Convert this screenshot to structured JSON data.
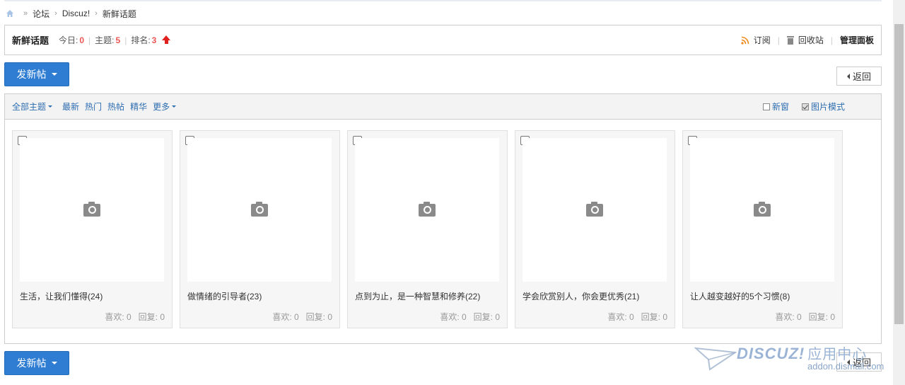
{
  "breadcrumb": {
    "items": [
      "论坛",
      "Discuz!",
      "新鲜话题"
    ],
    "separator": "›"
  },
  "forum": {
    "title": "新鲜话题",
    "today_label": "今日:",
    "today_value": "0",
    "topics_label": "主题:",
    "topics_value": "5",
    "rank_label": "排名:",
    "rank_value": "3",
    "subscribe_label": "订阅",
    "recycle_label": "回收站",
    "manage_label": "管理面板"
  },
  "actions": {
    "post_label": "发新帖",
    "back_label": "返回"
  },
  "filters": {
    "all_label": "全部主题",
    "latest_label": "最新",
    "hot_label": "热门",
    "hot_thread_label": "热帖",
    "digest_label": "精华",
    "more_label": "更多",
    "new_window_label": "新窗",
    "image_mode_label": "图片模式"
  },
  "threads": [
    {
      "title": "生活，让我们懂得(24)",
      "likes_label": "喜欢: 0",
      "replies_label": "回复: 0"
    },
    {
      "title": "做情绪的引导者(23)",
      "likes_label": "喜欢: 0",
      "replies_label": "回复: 0"
    },
    {
      "title": "点到为止，是一种智慧和修养(22)",
      "likes_label": "喜欢: 0",
      "replies_label": "回复: 0"
    },
    {
      "title": "学会欣赏别人，你会更优秀(21)",
      "likes_label": "喜欢: 0",
      "replies_label": "回复: 0"
    },
    {
      "title": "让人越变越好的5个习惯(8)",
      "likes_label": "喜欢: 0",
      "replies_label": "回复: 0"
    }
  ],
  "watermark": {
    "brand": "DISCUZ!",
    "brand_cn": "应用中心",
    "url": "addon.dismall.com"
  },
  "colors": {
    "accent": "#2e7dd2",
    "link": "#2e6db0",
    "stat_number": "#e55555",
    "rank_arrow": "#e0201e"
  }
}
